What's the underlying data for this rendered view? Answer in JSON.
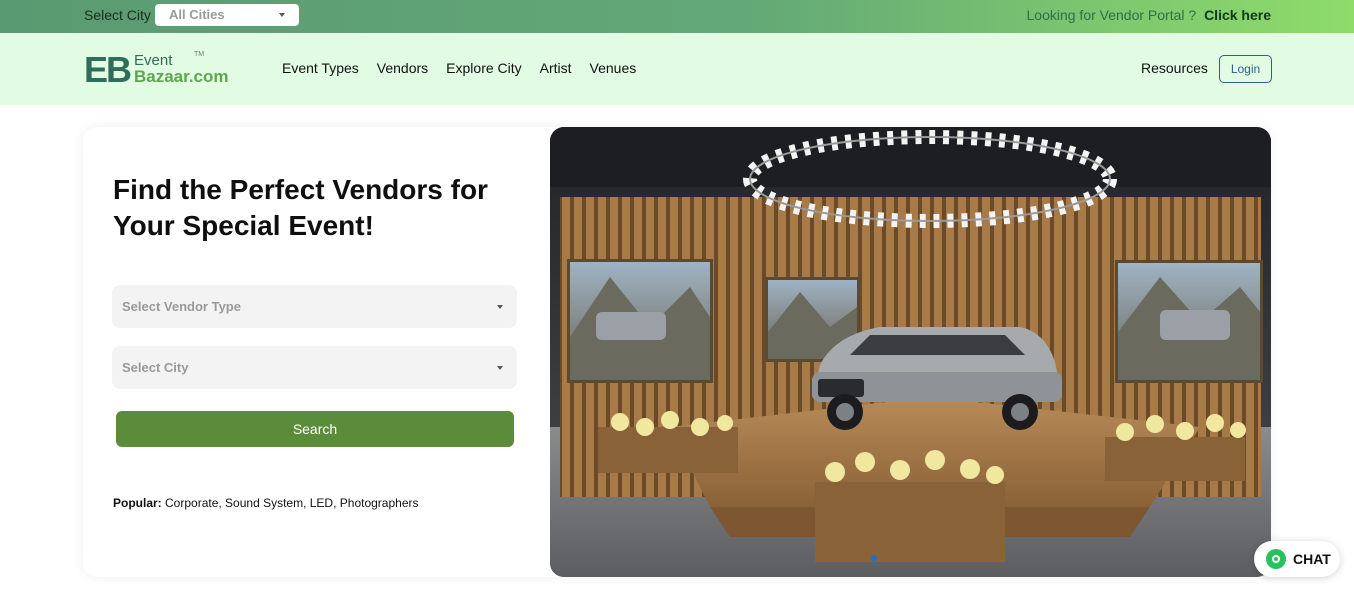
{
  "topbar": {
    "city_label": "Select City",
    "city_value": "All Cities",
    "vendor_text": "Looking for Vendor Portal ?",
    "vendor_link": "Click here"
  },
  "header": {
    "logo": {
      "line1": "Event",
      "line2": "Bazaar.com",
      "mark": "EB",
      "tm": "TM"
    },
    "nav": [
      "Event Types",
      "Vendors",
      "Explore City",
      "Artist",
      "Venues"
    ],
    "resources": "Resources",
    "login": "Login"
  },
  "hero": {
    "title": "Find the Perfect Vendors for Your Special Event!",
    "vendor_type_placeholder": "Select Vendor Type",
    "city_placeholder": "Select City",
    "search_label": "Search",
    "popular_label": "Popular:",
    "popular_items": "Corporate, Sound System, LED, Photographers"
  },
  "chat": {
    "label": "CHAT"
  },
  "colors": {
    "accent": "#5b8c3a",
    "brand_blue": "#2f5f8a",
    "header_bg": "#e2fbe3"
  }
}
